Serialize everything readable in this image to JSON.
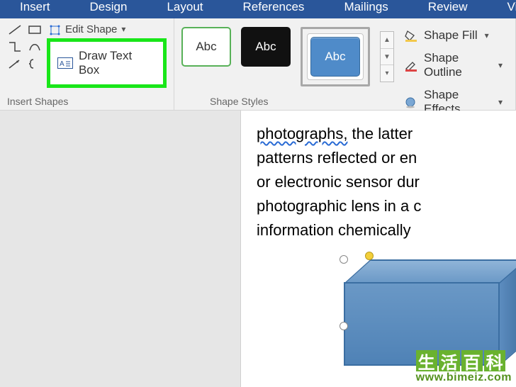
{
  "tabs": {
    "insert": "Insert",
    "design": "Design",
    "layout": "Layout",
    "references": "References",
    "mailings": "Mailings",
    "review": "Review",
    "view": "View"
  },
  "ribbon": {
    "insert_shapes": {
      "label": "Insert Shapes",
      "edit_shape": "Edit Shape",
      "draw_text_box": "Draw Text Box"
    },
    "shape_styles": {
      "label": "Shape Styles",
      "swatch_text": "Abc",
      "shape_fill": "Shape Fill",
      "shape_outline": "Shape Outline",
      "shape_effects": "Shape Effects"
    }
  },
  "doc_lines": {
    "l1a": "photographs,",
    "l1b": " the latter ",
    "l2": "patterns reflected or en",
    "l3": "or electronic sensor dur",
    "l4": "photographic lens in a c",
    "l5": "information chemically "
  },
  "watermark": {
    "c1": "生",
    "c2": "活",
    "c3": "百",
    "c4": "科",
    "url": "www.bimeiz.com"
  }
}
